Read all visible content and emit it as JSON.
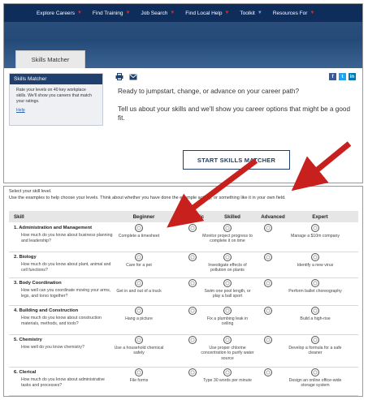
{
  "nav": {
    "items": [
      {
        "label": "Explore Careers",
        "arrow": "red"
      },
      {
        "label": "Find Training",
        "arrow": "red"
      },
      {
        "label": "Job Search",
        "arrow": "red"
      },
      {
        "label": "Find Local Help",
        "arrow": "red"
      },
      {
        "label": "Toolkit",
        "arrow": "blue"
      },
      {
        "label": "Resources For",
        "arrow": "red"
      }
    ]
  },
  "banner": {
    "tab_label": "Skills Matcher"
  },
  "sidebar": {
    "title": "Skills Matcher",
    "text": "Rate your levels on 40 key workplace skills. We'll show you careers that match your ratings.",
    "help_link": "Help"
  },
  "share": {
    "print_icon": "printer-icon",
    "email_icon": "email-icon",
    "social": [
      {
        "icon": "facebook-icon",
        "glyph": "f",
        "color": "#3b5998"
      },
      {
        "icon": "twitter-icon",
        "glyph": "t",
        "color": "#1da1f2"
      },
      {
        "icon": "linkedin-icon",
        "glyph": "in",
        "color": "#0077b5"
      }
    ]
  },
  "intro": {
    "line1": "Ready to jumpstart, change, or advance on your career path?",
    "line2": "Tell us about your skills and we'll show you career options that might be a good fit."
  },
  "start_button": "START SKILLS MATCHER",
  "matcher": {
    "instruction1": "Select your skill level.",
    "instruction2": "Use the examples to help choose your levels. Think about whether you have done the example activity, or something like it in your own field.",
    "headers": {
      "skill": "Skill",
      "levels": [
        "Beginner",
        "Basic",
        "Skilled",
        "Advanced",
        "Expert"
      ]
    },
    "skills": [
      {
        "title": "1. Administration and Management",
        "question": "How much do you know about business planning and leadership?",
        "examples": [
          "Complete a timesheet",
          "",
          "Monitor project progress to complete it on time",
          "",
          "Manage a $10m company"
        ]
      },
      {
        "title": "2. Biology",
        "question": "How much do you know about plant, animal and cell functions?",
        "examples": [
          "Care for a pet",
          "",
          "Investigate effects of pollution on plants",
          "",
          "Identify a new virus"
        ]
      },
      {
        "title": "3. Body Coordination",
        "question": "How well can you coordinate moving your arms, legs, and torso together?",
        "examples": [
          "Get in and out of a truck",
          "",
          "Swim one pool length, or play a ball sport",
          "",
          "Perform ballet choreography"
        ]
      },
      {
        "title": "4. Building and Construction",
        "question": "How much do you know about construction materials, methods, and tools?",
        "examples": [
          "Hang a picture",
          "",
          "Fix a plumbing leak in ceiling",
          "",
          "Build a high-rise"
        ]
      },
      {
        "title": "5. Chemistry",
        "question": "How well do you know chemistry?",
        "examples": [
          "Use a household chemical safely",
          "",
          "Use proper chlorine concentration to purify water source",
          "",
          "Develop a formula for a safe cleaner"
        ]
      },
      {
        "title": "6. Clerical",
        "question": "How much do you know about administrative tasks and processes?",
        "examples": [
          "File forms",
          "",
          "Type 30 words per minute",
          "",
          "Design an online office-wide storage system"
        ]
      }
    ]
  },
  "annotation": {
    "arrow_color": "#c8201c"
  }
}
